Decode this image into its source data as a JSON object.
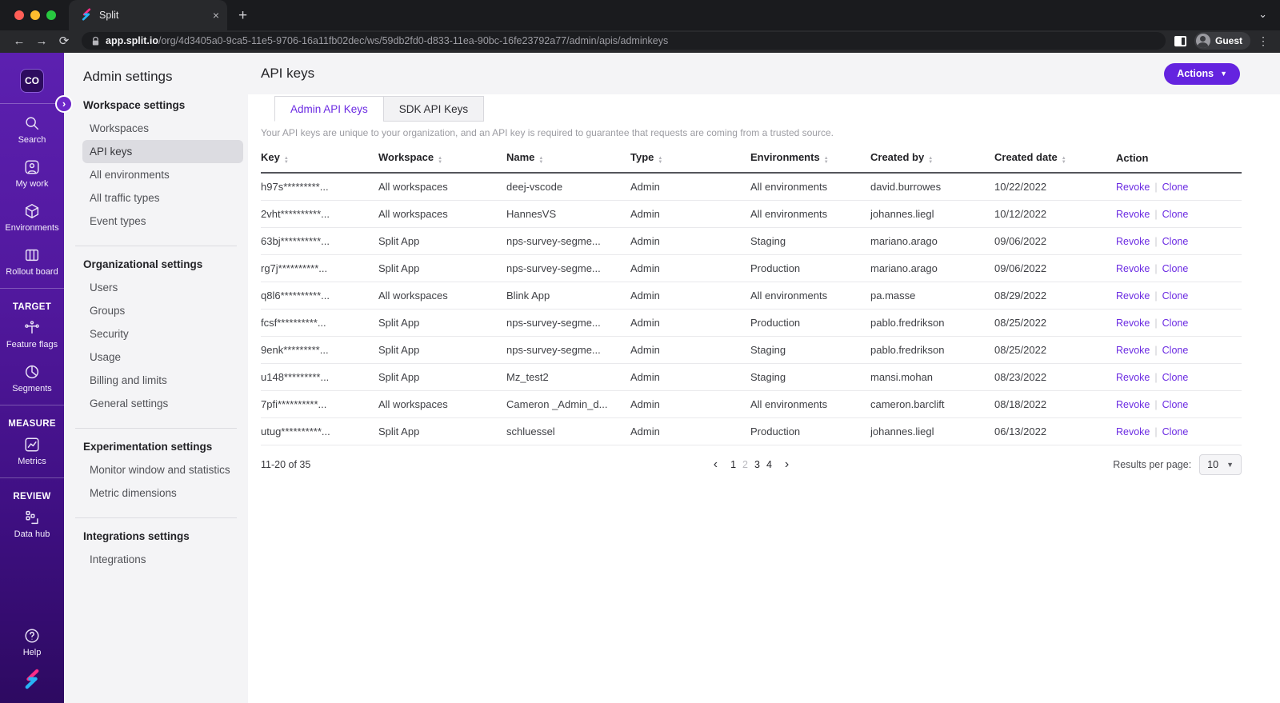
{
  "browser": {
    "tab_title": "Split",
    "url_domain": "app.split.io",
    "url_path": "/org/4d3405a0-9ca5-11e5-9706-16a11fb02dec/ws/59db2fd0-d833-11ea-90bc-16fe23792a77/admin/apis/adminkeys",
    "profile_label": "Guest"
  },
  "sidebar": {
    "workspace_badge": "CO",
    "sections": [
      {
        "header": "",
        "items": [
          {
            "icon": "search-icon",
            "label": "Search"
          },
          {
            "icon": "my-work-icon",
            "label": "My work"
          },
          {
            "icon": "environments-icon",
            "label": "Environments"
          },
          {
            "icon": "rollout-board-icon",
            "label": "Rollout board"
          }
        ]
      },
      {
        "header": "TARGET",
        "items": [
          {
            "icon": "feature-flags-icon",
            "label": "Feature flags"
          },
          {
            "icon": "segments-icon",
            "label": "Segments"
          }
        ]
      },
      {
        "header": "MEASURE",
        "items": [
          {
            "icon": "metrics-icon",
            "label": "Metrics"
          }
        ]
      },
      {
        "header": "REVIEW",
        "items": [
          {
            "icon": "data-hub-icon",
            "label": "Data hub"
          }
        ]
      }
    ],
    "help_label": "Help"
  },
  "settings_nav": {
    "title": "Admin settings",
    "groups": [
      {
        "header": "Workspace settings",
        "selected": "API keys",
        "items": [
          "Workspaces",
          "API keys",
          "All environments",
          "All traffic types",
          "Event types"
        ]
      },
      {
        "header": "Organizational settings",
        "selected": "",
        "items": [
          "Users",
          "Groups",
          "Security",
          "Usage",
          "Billing and limits",
          "General settings"
        ]
      },
      {
        "header": "Experimentation settings",
        "selected": "",
        "items": [
          "Monitor window and statistics",
          "Metric dimensions"
        ]
      },
      {
        "header": "Integrations settings",
        "selected": "",
        "items": [
          "Integrations"
        ]
      }
    ]
  },
  "main": {
    "title": "API keys",
    "actions_button": "Actions",
    "tabs": [
      {
        "label": "Admin API Keys",
        "active": true
      },
      {
        "label": "SDK API Keys",
        "active": false
      }
    ],
    "description": "Your API keys are unique to your organization, and an API key is required to guarantee that requests are coming from a trusted source.",
    "table": {
      "columns": [
        {
          "label": "Key",
          "sortable": true
        },
        {
          "label": "Workspace",
          "sortable": true
        },
        {
          "label": "Name",
          "sortable": true
        },
        {
          "label": "Type",
          "sortable": true
        },
        {
          "label": "Environments",
          "sortable": true
        },
        {
          "label": "Created by",
          "sortable": true
        },
        {
          "label": "Created date",
          "sortable": true
        },
        {
          "label": "Action",
          "sortable": false
        }
      ],
      "rows": [
        {
          "key": "h97s*********...",
          "workspace": "All workspaces",
          "name": "deej-vscode",
          "type": "Admin",
          "environments": "All environments",
          "created_by": "david.burrowes",
          "created_date": "10/22/2022"
        },
        {
          "key": "2vht**********...",
          "workspace": "All workspaces",
          "name": "HannesVS",
          "type": "Admin",
          "environments": "All environments",
          "created_by": "johannes.liegl",
          "created_date": "10/12/2022"
        },
        {
          "key": "63bj**********...",
          "workspace": "Split App",
          "name": "nps-survey-segme...",
          "type": "Admin",
          "environments": "Staging",
          "created_by": "mariano.arago",
          "created_date": "09/06/2022"
        },
        {
          "key": "rg7j**********...",
          "workspace": "Split App",
          "name": "nps-survey-segme...",
          "type": "Admin",
          "environments": "Production",
          "created_by": "mariano.arago",
          "created_date": "09/06/2022"
        },
        {
          "key": "q8l6**********...",
          "workspace": "All workspaces",
          "name": "Blink App",
          "type": "Admin",
          "environments": "All environments",
          "created_by": "pa.masse",
          "created_date": "08/29/2022"
        },
        {
          "key": "fcsf**********...",
          "workspace": "Split App",
          "name": "nps-survey-segme...",
          "type": "Admin",
          "environments": "Production",
          "created_by": "pablo.fredrikson",
          "created_date": "08/25/2022"
        },
        {
          "key": "9enk*********...",
          "workspace": "Split App",
          "name": "nps-survey-segme...",
          "type": "Admin",
          "environments": "Staging",
          "created_by": "pablo.fredrikson",
          "created_date": "08/25/2022"
        },
        {
          "key": "u148*********...",
          "workspace": "Split App",
          "name": "Mz_test2",
          "type": "Admin",
          "environments": "Staging",
          "created_by": "mansi.mohan",
          "created_date": "08/23/2022"
        },
        {
          "key": "7pfi**********...",
          "workspace": "All workspaces",
          "name": "Cameron _Admin_d...",
          "type": "Admin",
          "environments": "All environments",
          "created_by": "cameron.barclift",
          "created_date": "08/18/2022"
        },
        {
          "key": "utug**********...",
          "workspace": "Split App",
          "name": "schluessel",
          "type": "Admin",
          "environments": "Production",
          "created_by": "johannes.liegl",
          "created_date": "06/13/2022"
        }
      ],
      "action_links": [
        "Revoke",
        "Clone"
      ]
    },
    "pagination": {
      "range_label": "11-20 of 35",
      "pages": [
        "1",
        "2",
        "3",
        "4"
      ],
      "current_page": "2",
      "results_per_page_label": "Results per page:",
      "results_per_page_value": "10"
    }
  },
  "colors": {
    "accent_purple": "#6b2be2",
    "actions_button": "#6423df",
    "sidebar_gradient_top": "#5c20b0",
    "sidebar_gradient_bottom": "#2d0a61",
    "panel_background": "#f4f4f6",
    "selected_nav_background": "#dcdce1",
    "logo_pink": "#ff2d87",
    "logo_blue": "#27b4f5"
  }
}
